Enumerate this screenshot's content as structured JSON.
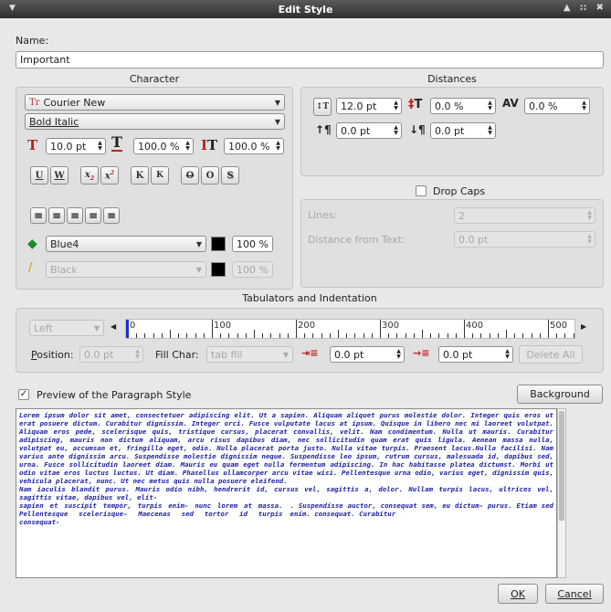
{
  "window": {
    "title": "Edit Style"
  },
  "name": {
    "label": "Name:",
    "value": "Important"
  },
  "character": {
    "title": "Character",
    "font_family": "Courier New",
    "font_style": "Bold Italic",
    "font_size": "10.0 pt",
    "width_scale": "100.0 %",
    "height_scale": "100.0 %",
    "fill_color": "Blue4",
    "fill_shade": "100 %",
    "stroke_color": "Black",
    "stroke_shade": "100 %",
    "fill_swatch": "#000000",
    "stroke_swatch": "#000000"
  },
  "distances": {
    "title": "Distances",
    "line_spacing": "12.0 pt",
    "baseline_offset": "0.0 %",
    "tracking": "0.0 %",
    "space_above": "0.0 pt",
    "space_below": "0.0 pt",
    "drop_caps_label": "Drop Caps",
    "lines_label": "Lines:",
    "lines_value": "2",
    "distance_label": "Distance from Text:",
    "distance_value": "0.0 pt"
  },
  "tabs": {
    "title": "Tabulators and Indentation",
    "alignment": "Left",
    "ruler_labels": [
      "0",
      "100",
      "200",
      "300",
      "400",
      "500"
    ],
    "position_label": "Position:",
    "position_value": "0.0 pt",
    "fill_char_label": "Fill Char:",
    "fill_char_value": "tab fill",
    "first_indent": "0.0 pt",
    "left_indent": "0.0 pt",
    "delete_all": "Delete All"
  },
  "preview": {
    "checkbox_label": "Preview of the Paragraph Style",
    "checked": true,
    "background_button": "Background",
    "para1": "Lorem ipsum dolor sit amet, consectetuer adipiscing elit. Ut a sapien. Aliquam aliquet purus molestie dolor. Integer quis eros ut erat posuere dictum. Curabitur dignissim. Integer orci. Fusce vulputate lacus at ipsum. Quisque in libero nec mi laoreet volutpat. Aliquam eros pede, scelerisque quis, tristique cursus, placerat convallis, velit. Nam condimentum. Nulla ut mauris. Curabitur adipiscing, mauris non dictum aliquam, arcu risus dapibus diam, nec sollicitudin quam erat quis ligula. Aenean massa nulla, volutpat eu, accumsan et, fringilla eget, odio. Nulla placerat porta justo. Nulla vitae turpis. Praesent lacus.Nulla facilisi. Nam varius ante dignissim arcu. Suspendisse molestie dignissim neque. Suspendisse leo ipsum, rutrum cursus, malesuada id, dapibus sed, urna. Fusce sollicitudin laoreet diam. Mauris eu quam eget nulla fermentum adipiscing. In hac habitasse platea dictumst. Morbi ut odio vitae eros luctus luctus. Ut diam. Phasellus ullamcorper arcu vitae wisi. Pellentesque urna odio, varius eget, dignissim quis, vehicula placerat, nunc. Ut nec metus quis nulla posuere eleifend.",
    "para2": "Nam iaculis blandit purus. Mauris odio nibh, hendrerit id, cursus vel, sagittis a, dolor. Nullam turpis lacus, ultrices vel, sagittis vitae, dapibus vel, elit-",
    "col1": "sapien et suscipit tempor, turpis enim- nunc lorem at massa. Pellentesque scelerisque- Maecenas sed tortor id turpis consequat-",
    "col2": ". Suspendisse auctor, consequat sem, eu dictum- purus. Etiam sed enim. consequat. Curabitur"
  },
  "buttons": {
    "ok": "OK",
    "cancel": "Cancel"
  }
}
